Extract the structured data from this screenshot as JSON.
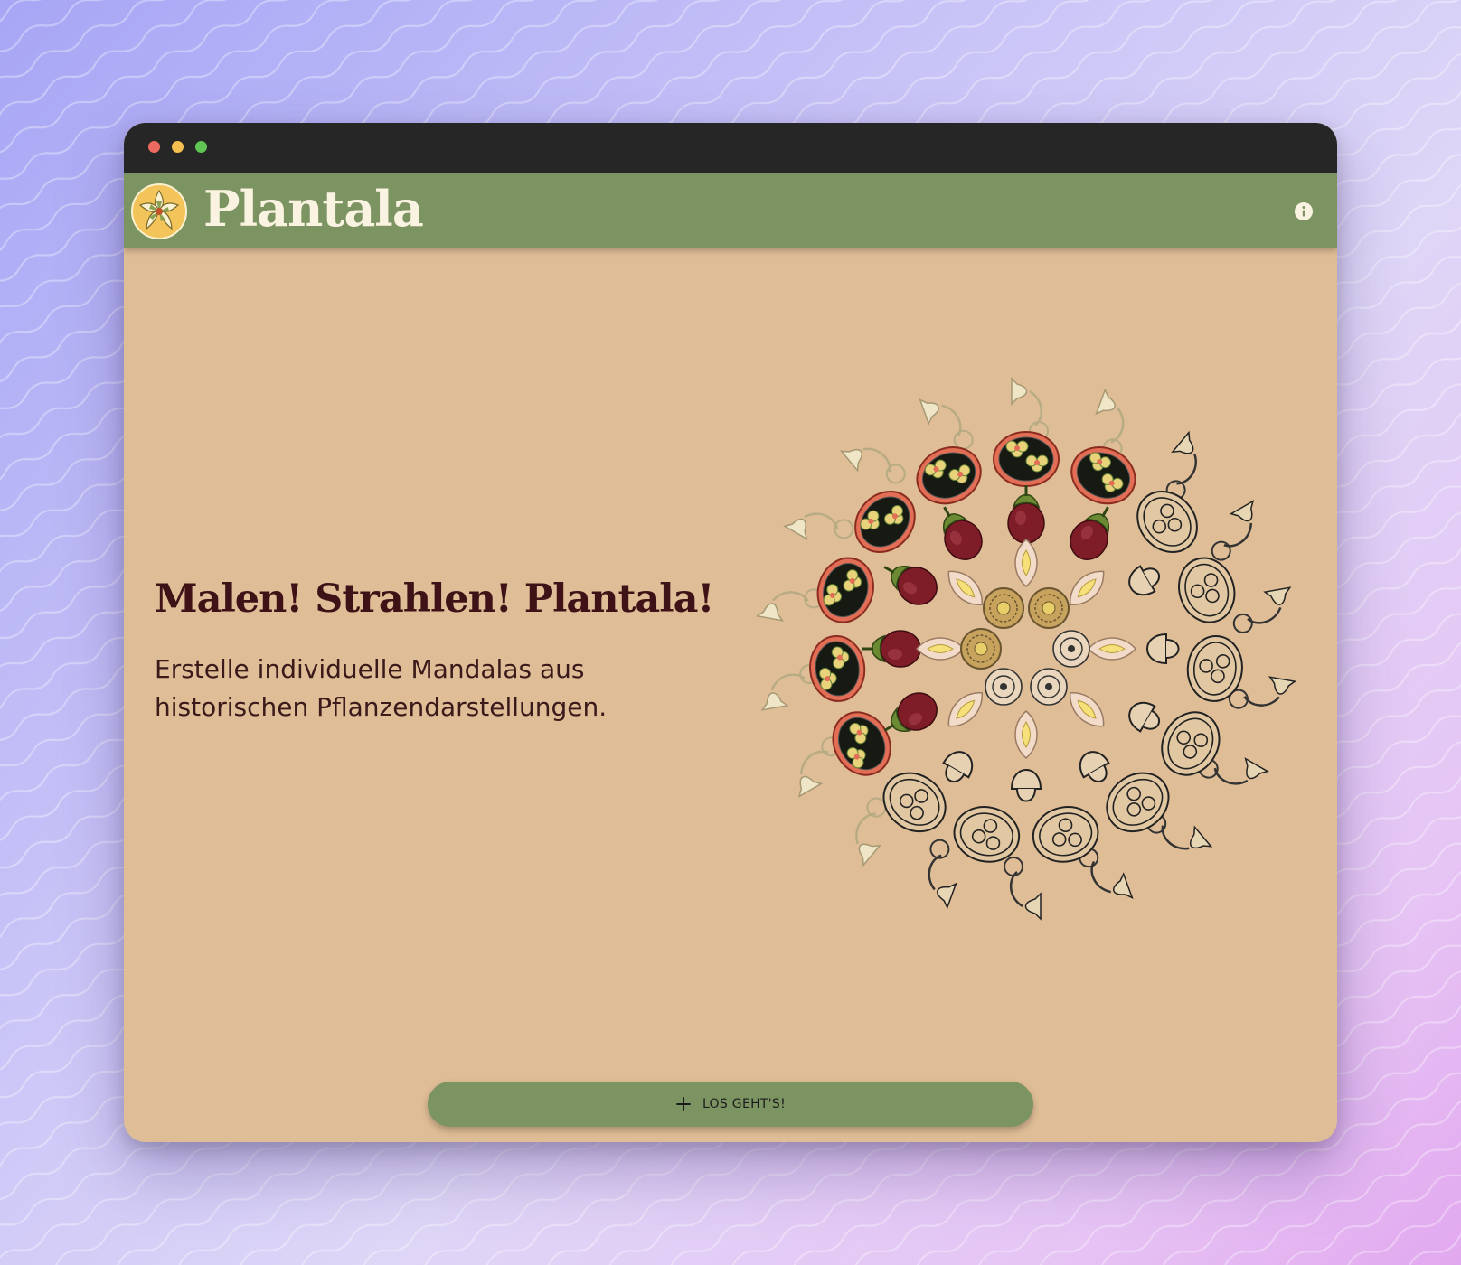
{
  "app": {
    "name": "Plantala"
  },
  "header": {
    "logo_icon": "flower-logo-icon",
    "info_icon": "info-icon"
  },
  "hero": {
    "headline": "Malen! Strahlen! Plantala!",
    "description": "Erstelle individuelle Mandalas aus historischen Pflanzendarstellungen."
  },
  "cta": {
    "icon": "plus-icon",
    "label": "LOS GEHT'S!"
  },
  "colors": {
    "page_bg": "#dfbd96",
    "appbar": "#7c9462",
    "titlebar": "#262626",
    "headline": "#3e1216",
    "brand_text": "#fbf3e2",
    "berry_red": "#8a1f2a",
    "leaf_green": "#5f7f35"
  }
}
